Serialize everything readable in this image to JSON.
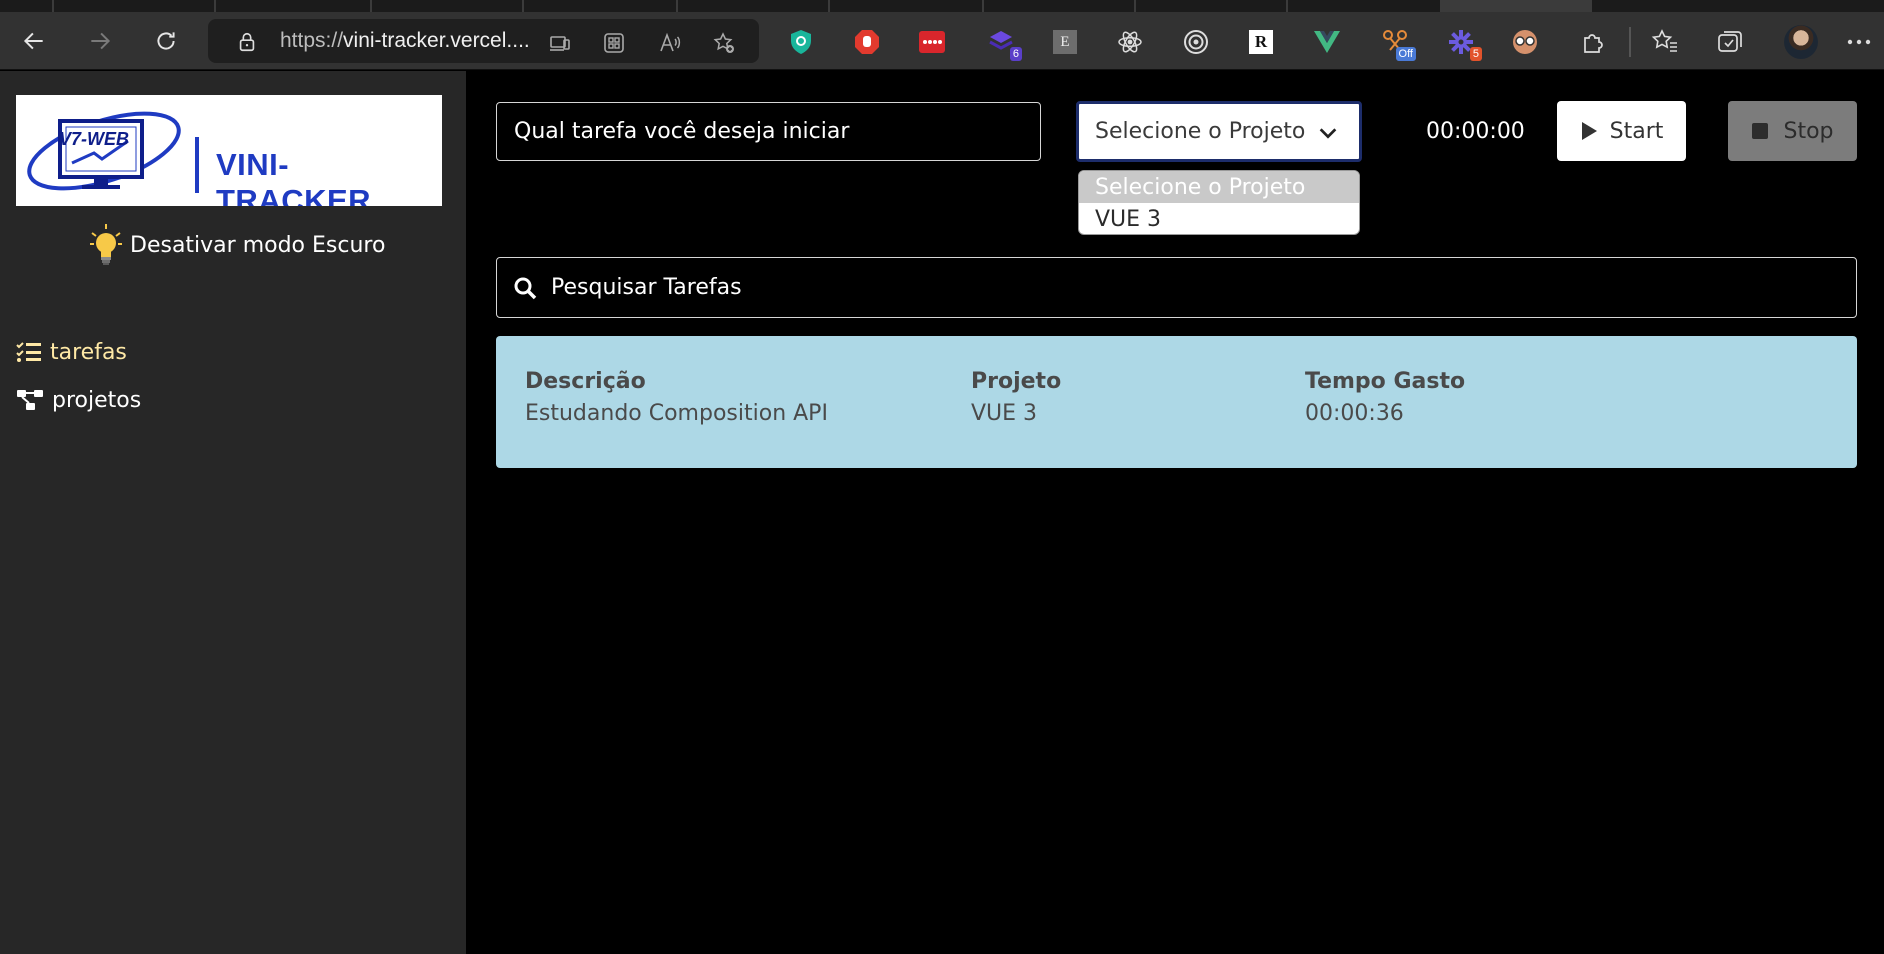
{
  "browser": {
    "url_prefix": "https://",
    "url_domain": "vini-tracker.vercel....",
    "extensions": [
      {
        "name": "shield-extension",
        "color": "#19b69b"
      },
      {
        "name": "hand-stop-extension",
        "color": "#e23a2e"
      },
      {
        "name": "password-extension",
        "color": "#d9262c"
      },
      {
        "name": "stack-extension",
        "color": "#5a2ec6",
        "badge": "6",
        "badge_color": "#5a3fc9"
      },
      {
        "name": "letter-e-extension",
        "color": "#6d6d6d"
      },
      {
        "name": "react-extension",
        "color": "#e8e8e8"
      },
      {
        "name": "target-extension",
        "color": "#e8e8e8"
      },
      {
        "name": "r-extension",
        "color": "#ffffff"
      },
      {
        "name": "vue-extension",
        "color": "#42b883"
      },
      {
        "name": "scissors-extension",
        "color": "#e58b3a",
        "badge": "Off",
        "badge_color": "#4a7ad6"
      },
      {
        "name": "gear-extension",
        "color": "#6b5bdf",
        "badge": "5",
        "badge_color": "#e2532b"
      },
      {
        "name": "glasses-extension",
        "color": "#d5916c"
      }
    ]
  },
  "sidebar": {
    "logo_tag": "V7-WEB",
    "logo_brand": "VINI-TRACKER",
    "darkmode_label": "Desativar modo Escuro",
    "nav": [
      {
        "label": "tarefas",
        "icon": "list-check-icon"
      },
      {
        "label": "projetos",
        "icon": "project-diagram-icon"
      }
    ]
  },
  "form": {
    "task_placeholder": "Qual tarefa você deseja iniciar",
    "project_selected": "Selecione o Projeto",
    "project_options": [
      "Selecione o Projeto",
      "VUE 3"
    ],
    "timer": "00:00:00",
    "start_label": "Start",
    "stop_label": "Stop"
  },
  "search": {
    "placeholder": "Pesquisar Tarefas"
  },
  "task": {
    "headers": {
      "description": "Descrição",
      "project": "Projeto",
      "time": "Tempo Gasto"
    },
    "description": "Estudando Composition API",
    "project": "VUE 3",
    "time": "00:00:36"
  },
  "colors": {
    "sidebar_bg": "#272727",
    "main_bg": "#000000",
    "task_card_bg": "#add8e6",
    "active_nav": "#ffe9a6",
    "brand_blue": "#1f3bc2"
  }
}
